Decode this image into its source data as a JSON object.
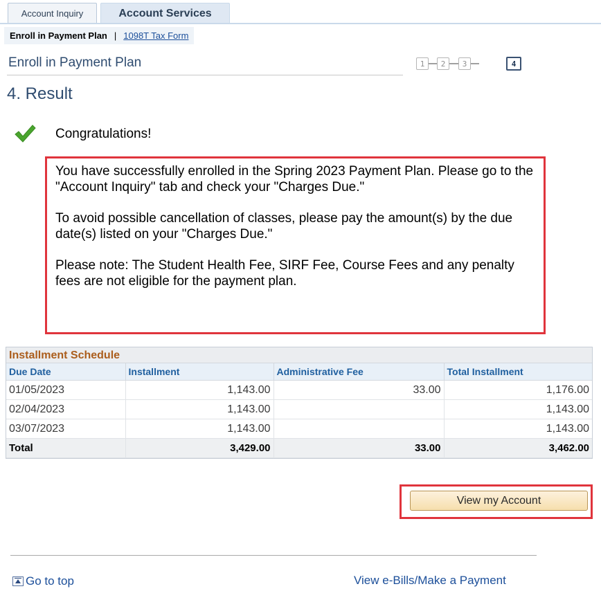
{
  "tabs": [
    {
      "label": "Account Inquiry",
      "active": false
    },
    {
      "label": "Account Services",
      "active": true
    }
  ],
  "subnav": {
    "current": "Enroll in Payment Plan",
    "separator": "|",
    "link": "1098T Tax Form"
  },
  "page_title": "Enroll in Payment Plan",
  "steps": [
    "1",
    "2",
    "3",
    "4"
  ],
  "active_step": "4",
  "section_title": "4. Result",
  "congrats": "Congratulations!",
  "message": {
    "p1": "You have successfully enrolled in the Spring 2023 Payment Plan. Please go to the \"Account Inquiry\" tab and check your \"Charges Due.\"",
    "p2": "To avoid possible cancellation of classes, please pay the amount(s) by the due date(s) listed on your \"Charges Due.\"",
    "p3": "Please note:  The Student Health Fee, SIRF Fee, Course Fees and any penalty fees are not eligible for the payment plan."
  },
  "schedule": {
    "caption": "Installment Schedule",
    "headers": [
      "Due Date",
      "Installment",
      "Administrative Fee",
      "Total Installment"
    ],
    "rows": [
      [
        "01/05/2023",
        "1,143.00",
        "33.00",
        "1,176.00"
      ],
      [
        "02/04/2023",
        "1,143.00",
        "",
        "1,143.00"
      ],
      [
        "03/07/2023",
        "1,143.00",
        "",
        "1,143.00"
      ]
    ],
    "total": [
      "Total",
      "3,429.00",
      "33.00",
      "3,462.00"
    ]
  },
  "view_account_button": "View my Account",
  "footer": {
    "go_to_top": "Go to top",
    "ebills_link": "View e-Bills/Make a Payment"
  },
  "colors": {
    "accent_red": "#e0343c",
    "link_blue": "#1c4f9a",
    "caption_orange": "#ab5d1c",
    "check_green": "#4aa52e"
  }
}
